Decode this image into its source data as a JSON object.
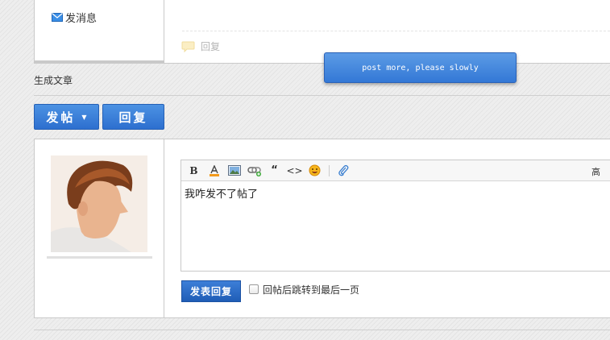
{
  "top": {
    "send_message": "发消息",
    "reply": "回复"
  },
  "section": {
    "label": "生成文章"
  },
  "toast": {
    "message": "post more, please slowly"
  },
  "actions": {
    "post_label": "发帖",
    "reply_label": "回复"
  },
  "editor": {
    "toolbar_right": "高",
    "content": "我咋发不了帖了"
  },
  "submit": {
    "label": "发表回复",
    "jump_label": "回帖后跳转到最后一页"
  },
  "colors": {
    "accent": "#2d6fcf",
    "toast": "#3378d6"
  },
  "icons": [
    "mail-icon",
    "speech-bubble-icon",
    "bold-icon",
    "font-color-icon",
    "image-icon",
    "link-icon",
    "quote-icon",
    "code-icon",
    "emoji-icon",
    "attachment-icon",
    "caret-down-icon"
  ]
}
